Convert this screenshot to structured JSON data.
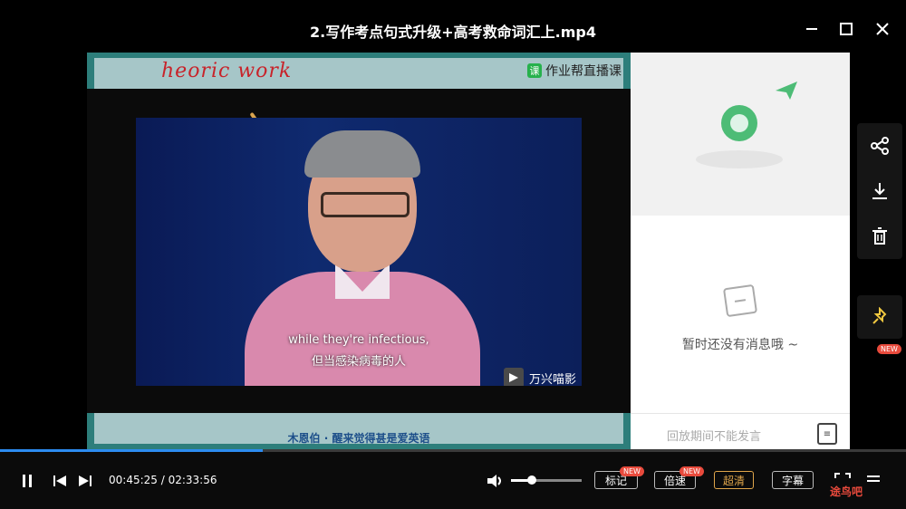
{
  "window": {
    "title": "2.写作考点句式升级+高考救命词汇上.mp4",
    "minimize_icon": "minimize-icon",
    "maximize_icon": "maximize-icon",
    "close_icon": "close-icon"
  },
  "slide": {
    "handwriting": "heoric work",
    "brand": "作业帮直播课",
    "brand_badge": "课",
    "bottom_caption": "木恩伯 · 醒来觉得甚是爱英语"
  },
  "video": {
    "subtitle_en": "while they're infectious,",
    "subtitle_zh": "但当感染病毒的人",
    "watermark": "万兴喵影"
  },
  "chat": {
    "empty_text": "暂时还没有消息哦 ~",
    "input_placeholder": "回放期间不能发言"
  },
  "side_tools": {
    "share_icon": "share-icon",
    "download_icon": "download-icon",
    "delete_icon": "trash-icon",
    "pin_icon": "pin-icon",
    "pin_badge": "NEW"
  },
  "player": {
    "progress": 0.29,
    "current_time": "00:45:25",
    "total_time": "02:33:56",
    "time_sep": " / ",
    "volume": 0.3,
    "buttons": [
      {
        "label": "标记",
        "badge": "NEW"
      },
      {
        "label": "倍速",
        "badge": "NEW"
      },
      {
        "label": "超清",
        "active": true
      },
      {
        "label": "字幕"
      }
    ],
    "accent": "#e0a64b"
  },
  "corner_logo": "途鸟吧"
}
